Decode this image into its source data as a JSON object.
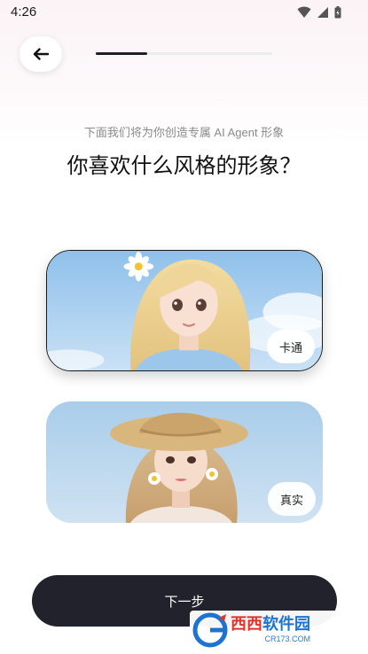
{
  "status_bar": {
    "time": "4:26",
    "icons": [
      "wifi-icon",
      "signal-icon",
      "battery-icon"
    ]
  },
  "header": {
    "back_icon": "arrow-left-icon",
    "progress": 0.29
  },
  "intro": {
    "subtitle": "下面我们将为你创造专属 AI Agent 形象",
    "title": "你喜欢什么风格的形象？"
  },
  "styles": [
    {
      "label": "卡通",
      "selected": true
    },
    {
      "label": "真实",
      "selected": false
    }
  ],
  "footer": {
    "next_label": "下一步"
  },
  "watermark": {
    "name_part1": "西西",
    "name_part2": "软件园",
    "url": "CR173.COM"
  },
  "colors": {
    "primary_dark": "#22222c",
    "subtitle_gray": "#8a8a8a",
    "watermark_blue": "#1e73d2",
    "watermark_red": "#e2332b"
  }
}
